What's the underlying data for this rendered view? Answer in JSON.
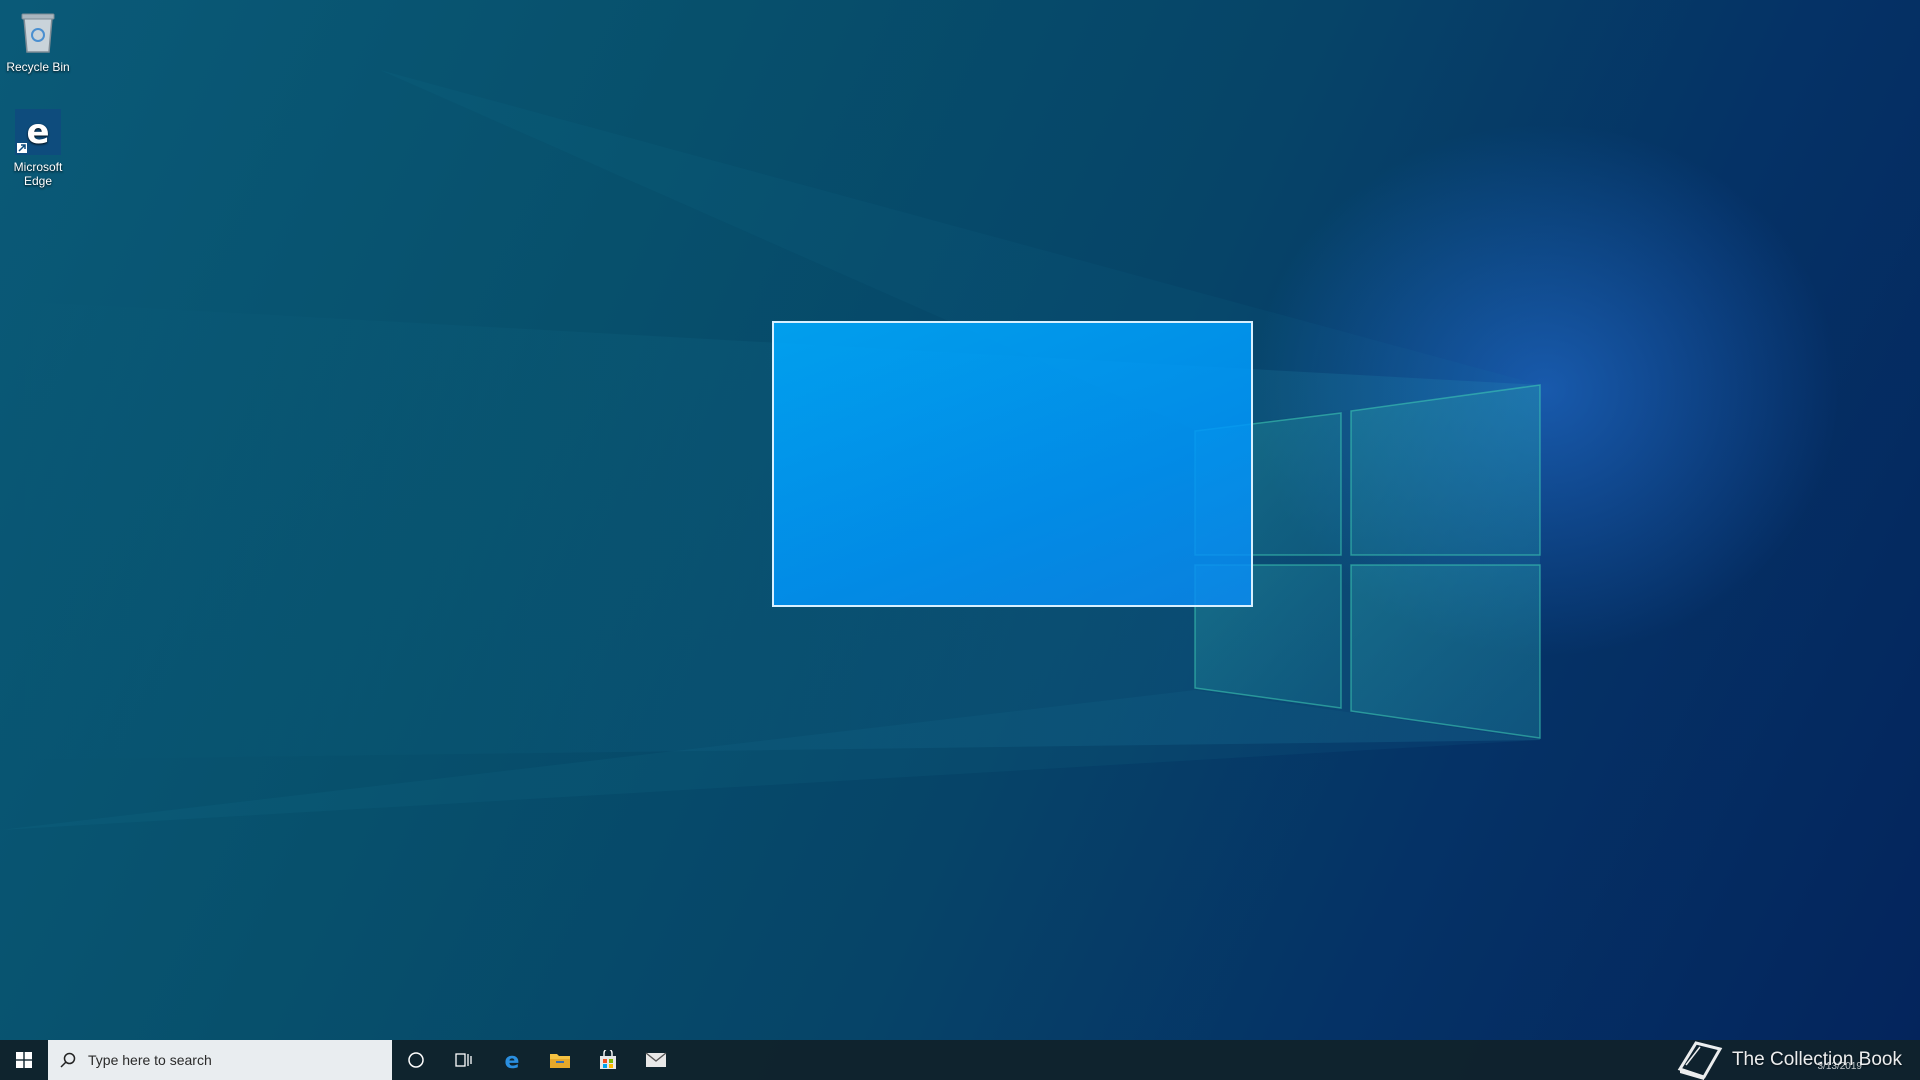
{
  "desktop": {
    "icons": [
      {
        "label": "Recycle Bin",
        "icon": "recycle-bin-icon"
      },
      {
        "label": "Microsoft Edge",
        "icon": "edge-icon"
      }
    ]
  },
  "taskbar": {
    "search": {
      "placeholder": "Type here to search"
    },
    "pinned": [
      "cortana-icon",
      "task-view-icon",
      "edge-icon",
      "file-explorer-icon",
      "store-icon",
      "mail-icon"
    ],
    "tray": {
      "watermark": "The Collection Book",
      "date": "3/13/2019"
    }
  },
  "colors": {
    "selection_fill": "#0aa0f5",
    "selection_border": "#d8f0ff",
    "taskbar": "#10222c",
    "search_box": "#e9edf0"
  }
}
